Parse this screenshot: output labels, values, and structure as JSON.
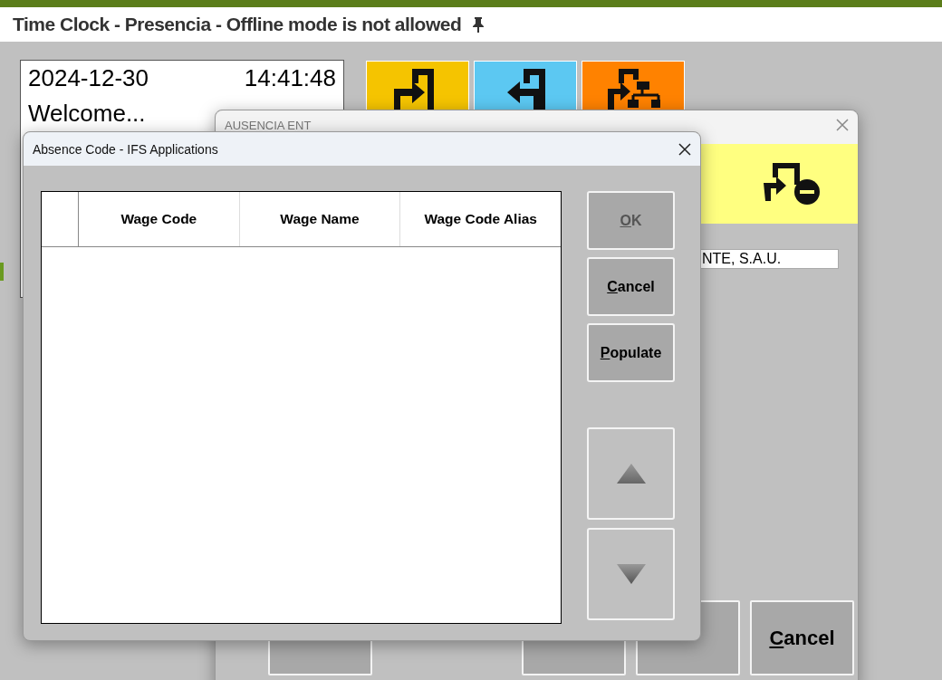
{
  "window": {
    "title": "Time Clock - Presencia - Offline mode is not allowed",
    "pinned": true
  },
  "clock": {
    "date": "2024-12-30",
    "time": "14:41:48",
    "greeting": "Welcome..."
  },
  "action_tiles": [
    {
      "kind": "enter",
      "color": "#f5c400"
    },
    {
      "kind": "leave",
      "color": "#5cc8f2"
    },
    {
      "kind": "transfer",
      "color": "#ff8200"
    }
  ],
  "back_dialog": {
    "title": "AUSENCIA ENT",
    "field_value": "NTE, S.A.U.",
    "buttons": [
      {
        "kind": "covered"
      },
      {
        "kind": "covered"
      },
      {
        "kind": "covered"
      },
      {
        "kind": "labeled",
        "label": "Cancel"
      }
    ]
  },
  "front_dialog": {
    "title": "Absence Code - IFS Applications",
    "table": {
      "columns": [
        "Wage Code",
        "Wage Name",
        "Wage Code Alias"
      ]
    },
    "buttons": [
      {
        "label": "OK",
        "disabled": true
      },
      {
        "label": "Cancel",
        "disabled": false
      },
      {
        "label": "Populate",
        "disabled": false
      }
    ],
    "scroll_buttons": [
      {
        "kind": "up"
      },
      {
        "kind": "down"
      }
    ]
  }
}
